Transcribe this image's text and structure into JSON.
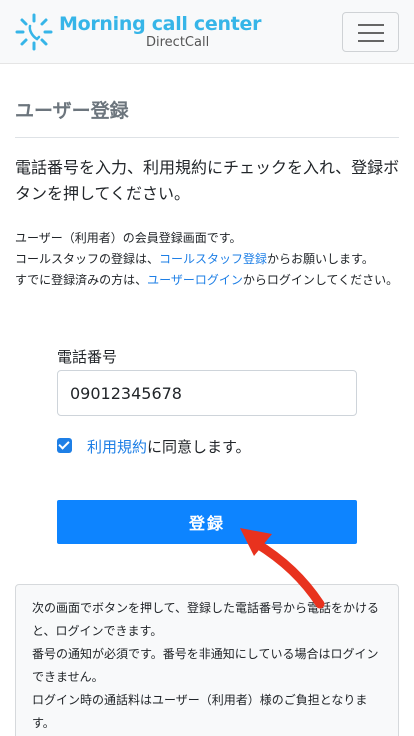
{
  "header": {
    "brand_title": "Morning call center",
    "brand_sub": "DirectCall"
  },
  "page": {
    "title": "ユーザー登録",
    "lead": "電話番号を入力、利用規約にチェックを入れ、登録ボタンを押してください。",
    "info_line1": "ユーザー（利用者）の会員登録画面です。",
    "info_line2_pre": "コールスタッフの登録は、",
    "info_line2_link": "コールスタッフ登録",
    "info_line2_post": "からお願いします。",
    "info_line3_pre": "すでに登録済みの方は、",
    "info_line3_link": "ユーザーログイン",
    "info_line3_post": "からログインしてください。"
  },
  "form": {
    "phone_label": "電話番号",
    "phone_value": "09012345678",
    "agree_link": "利用規約",
    "agree_text": "に同意します。",
    "agree_checked": true,
    "submit_label": "登録"
  },
  "notice": {
    "line1": "次の画面でボタンを押して、登録した電話番号から電話をかけると、ログインできます。",
    "line2": "番号の通知が必須です。番号を非通知にしている場合はログインできません。",
    "line3": "ログイン時の通話料はユーザー（利用者）様のご負担となります。"
  },
  "colors": {
    "accent": "#0d84ff",
    "link": "#1e7fe6",
    "brand": "#36b5e8",
    "annotation_arrow": "#e8321e"
  }
}
